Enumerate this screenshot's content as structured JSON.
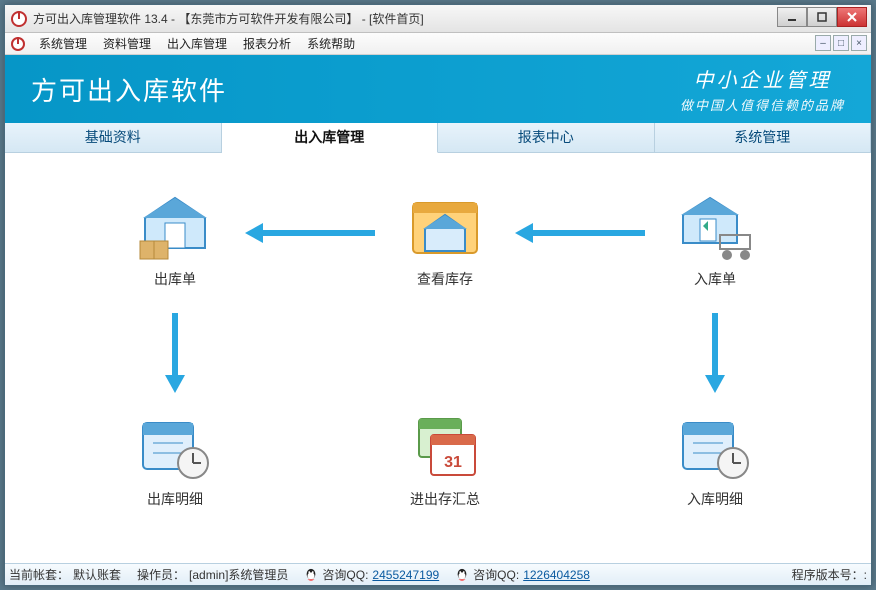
{
  "window": {
    "title": "方可出入库管理软件 13.4 -  【东莞市方可软件开发有限公司】  - [软件首页]"
  },
  "menu": {
    "items": [
      "系统管理",
      "资料管理",
      "出入库管理",
      "报表分析",
      "系统帮助"
    ]
  },
  "banner": {
    "title": "方可出入库软件",
    "right_line1": "中小企业管理",
    "right_line2": "做中国人值得信赖的品牌"
  },
  "tabs": {
    "items": [
      "基础资料",
      "出入库管理",
      "报表中心",
      "系统管理"
    ],
    "active_index": 1
  },
  "nodes": {
    "out_order": "出库单",
    "view_stock": "查看库存",
    "in_order": "入库单",
    "out_detail": "出库明细",
    "inout_summary": "进出存汇总",
    "in_detail": "入库明细"
  },
  "status": {
    "account_label": "当前帐套：",
    "account_value": "默认账套",
    "operator_label": "操作员：",
    "operator_value": "[admin]系统管理员",
    "qq1_label": "咨询QQ:",
    "qq1_value": "2455247199",
    "qq2_label": "咨询QQ:",
    "qq2_value": "1226404258",
    "version_label": "程序版本号：:"
  }
}
